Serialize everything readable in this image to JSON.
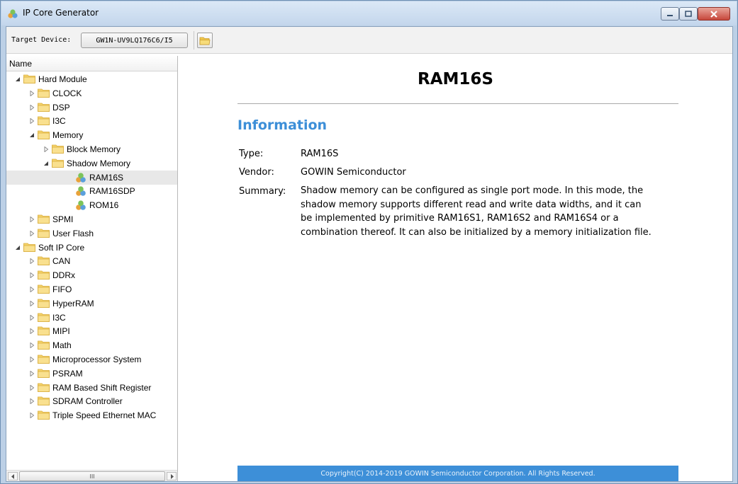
{
  "window": {
    "title": "IP Core Generator"
  },
  "toolbar": {
    "target_label": "Target Device:",
    "device_value": "GW1N-UV9LQ176C6/I5",
    "open_icon": "folder-open-icon"
  },
  "tree": {
    "header": "Name",
    "items": [
      {
        "label": "Hard Module",
        "level": 0,
        "expanded": true,
        "icon": "folder"
      },
      {
        "label": "CLOCK",
        "level": 1,
        "expanded": false,
        "icon": "folder"
      },
      {
        "label": "DSP",
        "level": 1,
        "expanded": false,
        "icon": "folder"
      },
      {
        "label": "I3C",
        "level": 1,
        "expanded": false,
        "icon": "folder"
      },
      {
        "label": "Memory",
        "level": 1,
        "expanded": true,
        "icon": "folder"
      },
      {
        "label": "Block Memory",
        "level": 2,
        "expanded": false,
        "icon": "folder"
      },
      {
        "label": "Shadow Memory",
        "level": 2,
        "expanded": true,
        "icon": "folder"
      },
      {
        "label": "RAM16S",
        "level": 3,
        "icon": "ip",
        "selected": true
      },
      {
        "label": "RAM16SDP",
        "level": 3,
        "icon": "ip"
      },
      {
        "label": "ROM16",
        "level": 3,
        "icon": "ip"
      },
      {
        "label": "SPMI",
        "level": 1,
        "expanded": false,
        "icon": "folder"
      },
      {
        "label": "User Flash",
        "level": 1,
        "expanded": false,
        "icon": "folder"
      },
      {
        "label": "Soft IP Core",
        "level": 0,
        "expanded": true,
        "icon": "folder"
      },
      {
        "label": "CAN",
        "level": 1,
        "expanded": false,
        "icon": "folder"
      },
      {
        "label": "DDRx",
        "level": 1,
        "expanded": false,
        "icon": "folder"
      },
      {
        "label": "FIFO",
        "level": 1,
        "expanded": false,
        "icon": "folder"
      },
      {
        "label": "HyperRAM",
        "level": 1,
        "expanded": false,
        "icon": "folder"
      },
      {
        "label": "I3C",
        "level": 1,
        "expanded": false,
        "icon": "folder"
      },
      {
        "label": "MIPI",
        "level": 1,
        "expanded": false,
        "icon": "folder"
      },
      {
        "label": "Math",
        "level": 1,
        "expanded": false,
        "icon": "folder"
      },
      {
        "label": "Microprocessor System",
        "level": 1,
        "expanded": false,
        "icon": "folder"
      },
      {
        "label": "PSRAM",
        "level": 1,
        "expanded": false,
        "icon": "folder"
      },
      {
        "label": "RAM Based Shift Register",
        "level": 1,
        "expanded": false,
        "icon": "folder"
      },
      {
        "label": "SDRAM Controller",
        "level": 1,
        "expanded": false,
        "icon": "folder"
      },
      {
        "label": "Triple Speed Ethernet MAC",
        "level": 1,
        "expanded": false,
        "icon": "folder"
      }
    ]
  },
  "content": {
    "title": "RAM16S",
    "section_heading": "Information",
    "type_label": "Type:",
    "type_value": "RAM16S",
    "vendor_label": "Vendor:",
    "vendor_value": "GOWIN Semiconductor",
    "summary_label": "Summary:",
    "summary_lines": [
      "Shadow memory can be configured as single port mode. In this mode, the",
      "shadow memory supports different read and write data widths, and it can",
      "be implemented by primitive RAM16S1, RAM16S2 and RAM16S4 or a",
      "combination thereof. It can also be initialized by a memory initialization file."
    ],
    "footer": "Copyright(C) 2014-2019 GOWIN Semiconductor Corporation. All Rights Reserved."
  },
  "scrollbar": {
    "thumb_grip": "III"
  },
  "colors": {
    "accent": "#3d8fd8",
    "folder": "#f2c94c",
    "selected_row": "#e8e8e8"
  }
}
